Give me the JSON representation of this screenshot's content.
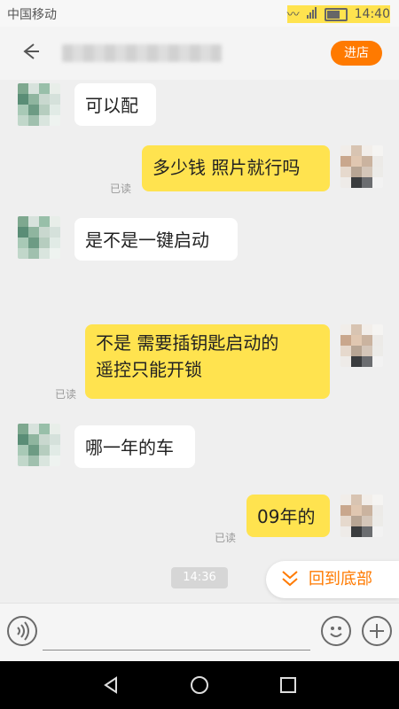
{
  "status_bar": {
    "carrier": "中国移动",
    "time": "14:40"
  },
  "header": {
    "store_button": "进店"
  },
  "messages": [
    {
      "side": "left",
      "text": "可以配"
    },
    {
      "side": "right",
      "text": "多少钱 照片就行吗",
      "read": "已读"
    },
    {
      "side": "left",
      "text": "是不是一键启动"
    },
    {
      "side": "right",
      "text": "不是 需要插钥匙启动的",
      "text2": "遥控只能开锁",
      "read": "已读"
    },
    {
      "side": "left",
      "text": "哪一年的车"
    },
    {
      "side": "right",
      "text": "09年的",
      "read": "已读"
    }
  ],
  "timestamp": "14:36",
  "jump_bottom": "回到底部",
  "colors": {
    "accent": "#ff7a00",
    "bubble_right": "#ffe34f",
    "bubble_left": "#ffffff"
  }
}
